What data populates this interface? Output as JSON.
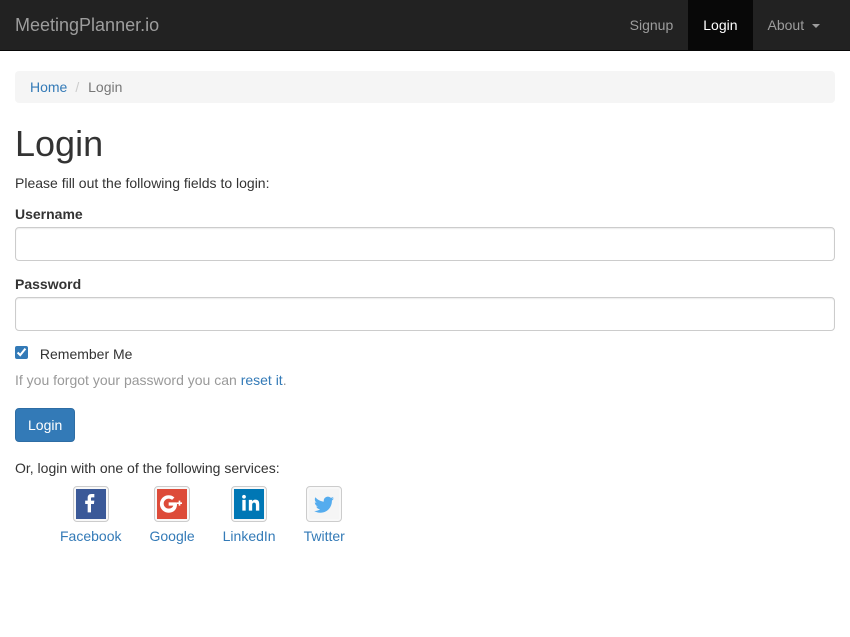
{
  "navbar": {
    "brand": "MeetingPlanner.io",
    "items": [
      {
        "label": "Signup",
        "active": false
      },
      {
        "label": "Login",
        "active": true
      },
      {
        "label": "About",
        "active": false,
        "dropdown": true
      }
    ]
  },
  "breadcrumb": {
    "home": "Home",
    "current": "Login"
  },
  "page": {
    "title": "Login",
    "subtitle": "Please fill out the following fields to login:"
  },
  "form": {
    "username_label": "Username",
    "username_value": "",
    "password_label": "Password",
    "password_value": "",
    "remember_label": "Remember Me",
    "remember_checked": true,
    "forgot_prefix": "If you forgot your password you can ",
    "forgot_link": "reset it",
    "forgot_suffix": ".",
    "submit": "Login"
  },
  "social": {
    "prompt": "Or, login with one of the following services:",
    "providers": [
      {
        "name": "Facebook",
        "icon": "facebook-icon"
      },
      {
        "name": "Google",
        "icon": "google-plus-icon"
      },
      {
        "name": "LinkedIn",
        "icon": "linkedin-icon"
      },
      {
        "name": "Twitter",
        "icon": "twitter-icon"
      }
    ]
  },
  "colors": {
    "link": "#337ab7",
    "navbar_bg": "#222222",
    "navbar_active_bg": "#080808"
  }
}
